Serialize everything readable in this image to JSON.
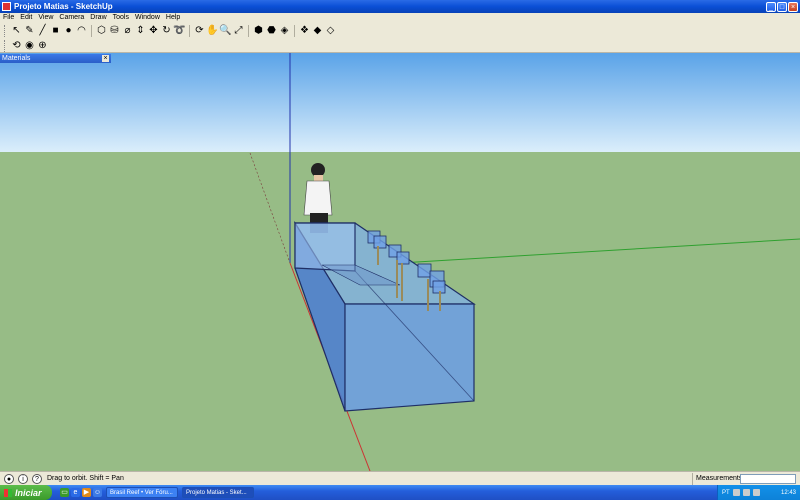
{
  "window": {
    "title": "Projeto Matias - SketchUp",
    "buttons": [
      "_",
      "□",
      "×"
    ]
  },
  "menubar": [
    "File",
    "Edit",
    "View",
    "Camera",
    "Draw",
    "Tools",
    "Window",
    "Help"
  ],
  "toolbar_main": [
    {
      "name": "select-tool-icon",
      "glyph": "↖"
    },
    {
      "name": "eraser-tool-icon",
      "glyph": "✎"
    },
    {
      "name": "pencil-tool-icon",
      "glyph": "╱"
    },
    {
      "name": "rectangle-tool-icon",
      "glyph": "■"
    },
    {
      "name": "circle-tool-icon",
      "glyph": "●"
    },
    {
      "name": "arc-tool-icon",
      "glyph": "◠"
    },
    {
      "name": "sep"
    },
    {
      "name": "make-component-icon",
      "glyph": "⬡"
    },
    {
      "name": "paint-bucket-icon",
      "glyph": "⛁"
    },
    {
      "name": "tape-measure-icon",
      "glyph": "⌀"
    },
    {
      "name": "push-pull-icon",
      "glyph": "⇕"
    },
    {
      "name": "move-tool-icon",
      "glyph": "✥"
    },
    {
      "name": "rotate-tool-icon",
      "glyph": "↻"
    },
    {
      "name": "follow-me-icon",
      "glyph": "➰"
    },
    {
      "name": "sep"
    },
    {
      "name": "orbit-tool-icon",
      "glyph": "⟳"
    },
    {
      "name": "pan-tool-icon",
      "glyph": "✋"
    },
    {
      "name": "zoom-tool-icon",
      "glyph": "🔍"
    },
    {
      "name": "zoom-extents-icon",
      "glyph": "⤢"
    },
    {
      "name": "sep"
    },
    {
      "name": "get-models-icon",
      "glyph": "⬢"
    },
    {
      "name": "share-model-icon",
      "glyph": "⬣"
    },
    {
      "name": "warehouse-icon",
      "glyph": "◈"
    },
    {
      "name": "sep"
    },
    {
      "name": "components-icon",
      "glyph": "❖"
    },
    {
      "name": "materials-icon",
      "glyph": "◆"
    },
    {
      "name": "styles-icon",
      "glyph": "◇"
    }
  ],
  "toolbar_secondary": [
    {
      "name": "walk-tool-icon",
      "glyph": "⟲"
    },
    {
      "name": "look-around-icon",
      "glyph": "◉"
    },
    {
      "name": "position-camera-icon",
      "glyph": "⊕"
    }
  ],
  "materials_panel": {
    "title": "Materials",
    "close": "×"
  },
  "colors": {
    "sky_top": "#5aa3e8",
    "sky_bottom": "#dbeefb",
    "ground": "#97bc86",
    "aquarium_fill": "#5b8fd9",
    "aquarium_edge": "#1f2f66"
  },
  "statusbar": {
    "hint": "Drag to orbit.  Shift = Pan",
    "measurements_label": "Measurements",
    "measurements_value": ""
  },
  "taskbar": {
    "start_label": "Iniciar",
    "tasks": [
      {
        "label": "Brasil Reef • Ver Fóru...",
        "active": false
      },
      {
        "label": "Projeto Matias - Sket...",
        "active": true
      }
    ],
    "tray_lang": "PT",
    "clock": "12:43"
  }
}
